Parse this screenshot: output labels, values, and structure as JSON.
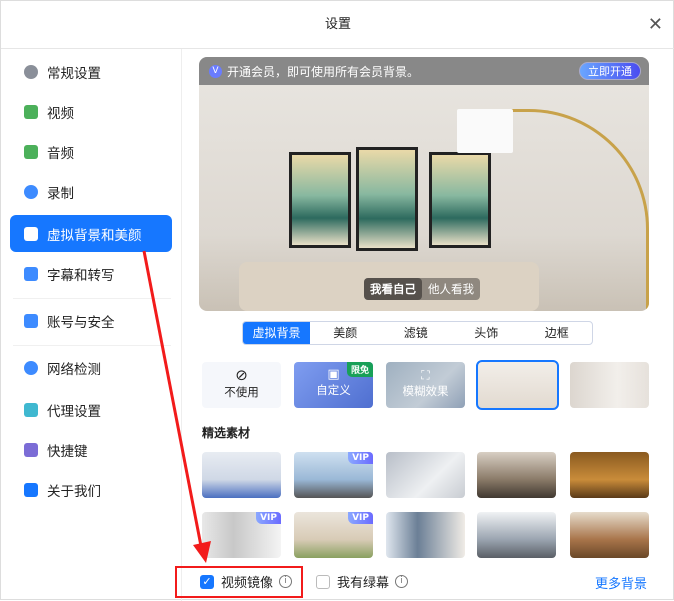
{
  "window": {
    "title": "设置",
    "close_icon": "close-icon"
  },
  "sidebar": {
    "items": [
      {
        "label": "常规设置",
        "icon": "gear-icon",
        "color": "#8a8f99"
      },
      {
        "label": "视频",
        "icon": "video-camera-icon",
        "color": "#4cb05a"
      },
      {
        "label": "音频",
        "icon": "speaker-icon",
        "color": "#4cb05a"
      },
      {
        "label": "录制",
        "icon": "record-icon",
        "color": "#3d8bff"
      },
      {
        "label": "虚拟背景和美颜",
        "icon": "portrait-icon",
        "color": "#ffffff",
        "active": true
      },
      {
        "label": "字幕和转写",
        "icon": "caption-icon",
        "color": "#3d8bff"
      },
      {
        "label": "账号与安全",
        "icon": "user-lock-icon",
        "color": "#3d8bff"
      },
      {
        "label": "网络检测",
        "icon": "globe-icon",
        "color": "#3d8bff"
      },
      {
        "label": "代理设置",
        "icon": "network-tree-icon",
        "color": "#3fb8d0"
      },
      {
        "label": "快捷键",
        "icon": "keyboard-icon",
        "color": "#7b6cd6"
      },
      {
        "label": "关于我们",
        "icon": "logo-icon",
        "color": "#1677ff"
      }
    ]
  },
  "banner": {
    "text": "开通会员，即可使用所有会员背景。",
    "button": "立即开通"
  },
  "preview": {
    "toggle": [
      "我看自己",
      "他人看我"
    ],
    "active_toggle": "我看自己"
  },
  "tabs": {
    "items": [
      "虚拟背景",
      "美颜",
      "滤镜",
      "头饰",
      "边框"
    ],
    "active": "虚拟背景"
  },
  "options": {
    "none": "不使用",
    "custom": "自定义",
    "custom_badge": "限免",
    "blur": "模糊效果"
  },
  "section_title": "精选素材",
  "vip_badge": "VIP",
  "bottom": {
    "mirror_label": "视频镜像",
    "mirror_checked": true,
    "green_label": "我有绿幕",
    "green_checked": false,
    "more": "更多背景"
  },
  "colors": {
    "accent": "#1677ff",
    "annotation": "#f21b1b"
  }
}
